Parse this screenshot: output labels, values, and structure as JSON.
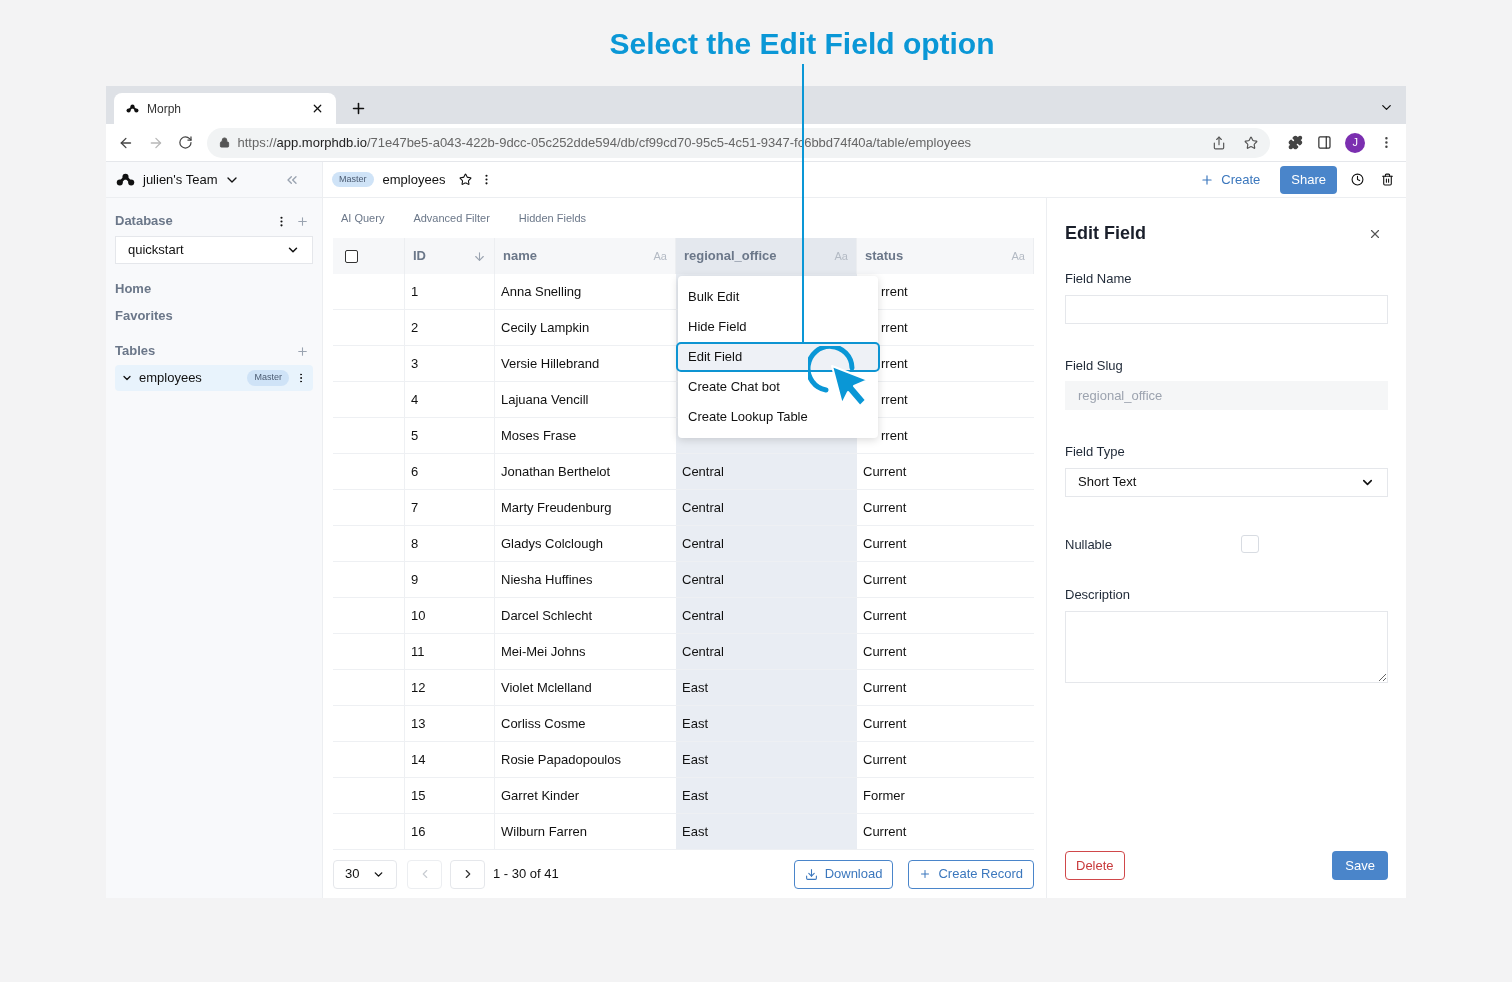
{
  "annotation": {
    "title": "Select the Edit Field option"
  },
  "browser": {
    "tab_title": "Morph",
    "url": {
      "scheme": "https://",
      "host": "app.morphdb.io",
      "path": "/71e47be5-a043-422b-9dcc-05c252dde594/db/cf99cd70-95c5-4c51-9347-fc6bbd74f40a/table/employees"
    },
    "forward_disabled": true,
    "profile_initial": "J"
  },
  "app_header": {
    "team": "julien's Team",
    "branch_badge": "Master",
    "table_name": "employees",
    "create_label": "Create",
    "share_label": "Share"
  },
  "sidebar": {
    "database_label": "Database",
    "database": "quickstart",
    "nav": [
      {
        "label": "Home"
      },
      {
        "label": "Favorites"
      }
    ],
    "tables_label": "Tables",
    "tables": [
      {
        "name": "employees",
        "badge": "Master",
        "selected": true,
        "expanded": true
      }
    ]
  },
  "toolbar": [
    "AI Query",
    "Advanced Filter",
    "Hidden Fields"
  ],
  "table": {
    "select_all": {
      "checked": false
    },
    "columns": [
      {
        "label": "ID",
        "kind": "number",
        "selected": false
      },
      {
        "label": "name",
        "kind": "text",
        "type_label": "Aa",
        "selected": false
      },
      {
        "label": "regional_office",
        "kind": "text",
        "type_label": "Aa",
        "selected": true
      },
      {
        "label": "status",
        "kind": "text",
        "type_label": "Aa",
        "selected": false
      }
    ],
    "rows": [
      {
        "id": "1",
        "name": "Anna Snelling",
        "status": "rrent",
        "status_covered": true
      },
      {
        "id": "2",
        "name": "Cecily Lampkin",
        "status": "rrent",
        "status_covered": true
      },
      {
        "id": "3",
        "name": "Versie Hillebrand",
        "status": "rrent",
        "status_covered": true
      },
      {
        "id": "4",
        "name": "Lajuana Vencill",
        "status": "rrent",
        "status_covered": true
      },
      {
        "id": "5",
        "name": "Moses Frase",
        "status": "rrent",
        "status_covered": true
      },
      {
        "id": "6",
        "name": "Jonathan Berthelot",
        "regional_office": "Central",
        "status": "Current"
      },
      {
        "id": "7",
        "name": "Marty Freudenburg",
        "regional_office": "Central",
        "status": "Current"
      },
      {
        "id": "8",
        "name": "Gladys Colclough",
        "regional_office": "Central",
        "status": "Current"
      },
      {
        "id": "9",
        "name": "Niesha Huffines",
        "regional_office": "Central",
        "status": "Current"
      },
      {
        "id": "10",
        "name": "Darcel Schlecht",
        "regional_office": "Central",
        "status": "Current"
      },
      {
        "id": "11",
        "name": "Mei-Mei Johns",
        "regional_office": "Central",
        "status": "Current"
      },
      {
        "id": "12",
        "name": "Violet Mclelland",
        "regional_office": "East",
        "status": "Current"
      },
      {
        "id": "13",
        "name": "Corliss Cosme",
        "regional_office": "East",
        "status": "Current"
      },
      {
        "id": "14",
        "name": "Rosie Papadopoulos",
        "regional_office": "East",
        "status": "Current"
      },
      {
        "id": "15",
        "name": "Garret Kinder",
        "regional_office": "East",
        "status": "Former"
      },
      {
        "id": "16",
        "name": "Wilburn Farren",
        "regional_office": "East",
        "status": "Current"
      }
    ]
  },
  "context_menu": {
    "items": [
      {
        "label": "Bulk Edit",
        "selected": false
      },
      {
        "label": "Hide Field",
        "selected": false
      },
      {
        "label": "Edit Field",
        "selected": true
      },
      {
        "label": "Create Chat bot",
        "selected": false
      },
      {
        "label": "Create Lookup Table",
        "selected": false
      }
    ]
  },
  "pagination": {
    "page_size": "30",
    "prev_disabled": true,
    "range": "1 - 30 of 41"
  },
  "actions": [
    {
      "label": "Download",
      "kind": "download"
    },
    {
      "label": "Create Record",
      "kind": "create"
    }
  ],
  "edit_panel": {
    "title": "Edit Field",
    "fields": [
      {
        "kind": "text",
        "label": "Field Name"
      },
      {
        "kind": "text",
        "label": "Field Slug",
        "value": "regional_office",
        "disabled": true
      },
      {
        "kind": "select",
        "label": "Field Type",
        "value": "Short Text"
      },
      {
        "kind": "checkbox",
        "label": "Nullable",
        "checked": false
      },
      {
        "kind": "textarea",
        "label": "Description"
      }
    ],
    "delete_label": "Delete",
    "save_label": "Save"
  }
}
